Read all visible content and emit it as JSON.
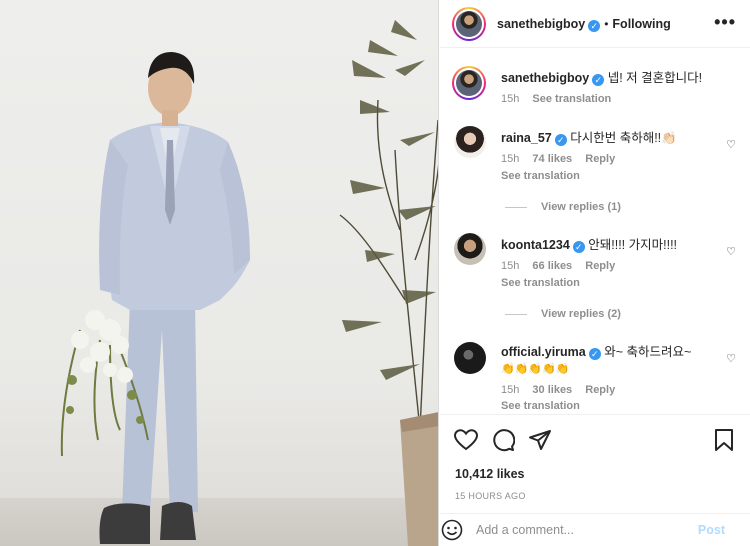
{
  "post": {
    "author": "sanethebigboy",
    "follow_status": "Following",
    "dot": "•",
    "more": "•••",
    "caption": {
      "username": "sanethebigboy",
      "text": "넵! 저 결혼합니다!",
      "time": "15h",
      "see_translation": "See translation"
    },
    "comments": [
      {
        "username": "raina_57",
        "text": "다시한번 축하해!!👏🏻",
        "time": "15h",
        "likes": "74 likes",
        "reply": "Reply",
        "see_translation": "See translation",
        "view_replies": "View replies (1)"
      },
      {
        "username": "koonta1234",
        "text": "안돼!!!! 가지마!!!!",
        "time": "15h",
        "likes": "66 likes",
        "reply": "Reply",
        "see_translation": "See translation",
        "view_replies": "View replies (2)"
      },
      {
        "username": "official.yiruma",
        "text": "와~ 축하드려요~",
        "emoji_line": "👏👏👏👏👏",
        "time": "15h",
        "likes": "30 likes",
        "reply": "Reply",
        "see_translation": "See translation"
      }
    ],
    "like_count": "10,412 likes",
    "posted": "15 HOURS AGO",
    "comment_placeholder": "Add a comment...",
    "post_button": "Post"
  },
  "icons": {
    "like": "heart-icon",
    "comment": "comment-icon",
    "share": "paper-plane-icon",
    "save": "bookmark-icon",
    "emoji": "smiley-icon",
    "comment_like": "small-heart-icon"
  },
  "colors": {
    "verified": "#3897f0",
    "post_disabled": "#b3dbff",
    "muted": "#8e8e8e"
  }
}
